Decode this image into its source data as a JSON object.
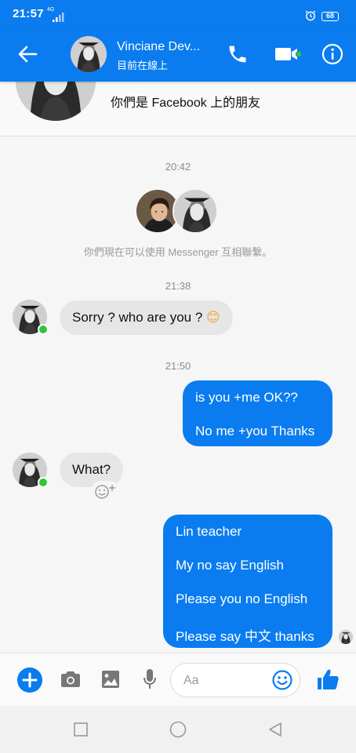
{
  "status_bar": {
    "time": "21:57",
    "network": "4G",
    "battery": "68"
  },
  "header": {
    "name": "Vinciane Dev...",
    "status": "目前在線上"
  },
  "profile": {
    "friends_text": "你們是 Facebook 上的朋友"
  },
  "chat": {
    "timestamps": [
      "20:42",
      "21:38",
      "21:50"
    ],
    "connected_note": "你們現在可以使用 Messenger 互相聯繫。",
    "incoming_1": "Sorry ? who are you ? ",
    "incoming_1_emoji": "😊",
    "outgoing_1": [
      "is you +me OK??",
      "No me +you Thanks"
    ],
    "incoming_2": "What?",
    "outgoing_2": [
      "Lin teacher",
      "My no say English",
      "Please you no English",
      "Please say 中文 thanks"
    ]
  },
  "composer": {
    "placeholder": "Aa"
  },
  "colors": {
    "brand_blue": "#0a7cf0",
    "online_green": "#32c43b",
    "incoming_bubble": "#e6e6e6"
  },
  "icons": [
    "back-arrow-icon",
    "phone-icon",
    "video-camera-icon",
    "info-icon",
    "plus-icon",
    "camera-icon",
    "image-icon",
    "microphone-icon",
    "emoji-icon",
    "thumbs-up-icon",
    "square-icon",
    "circle-icon",
    "triangle-back-icon"
  ]
}
